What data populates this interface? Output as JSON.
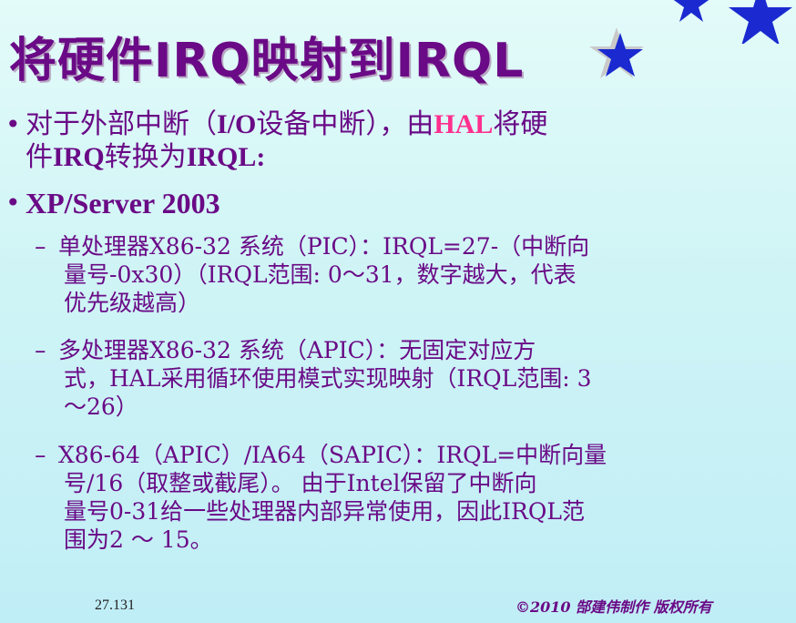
{
  "title": "将硬件IRQ映射到IRQL",
  "bullet1": {
    "line1_pre": "对于外部中断（",
    "line1_io": "I/O",
    "line1_mid": "设备中断），由",
    "line1_hal": "HAL",
    "line1_post": "将硬",
    "line2_pre": "件",
    "line2_irq": "IRQ",
    "line2_mid": "转换为",
    "line2_irql": "IRQL:"
  },
  "bullet2": {
    "text": "XP/Server 2003"
  },
  "sub1": {
    "line1": "单处理器X86-32 系统（PIC）：IRQL=27-（中断向",
    "line2": "量号-0x30）（IRQL范围: 0～31，数字越大，代表",
    "line3": "优先级越高）"
  },
  "sub2": {
    "line1": "多处理器X86-32 系统（APIC）：无固定对应方",
    "line2": "式，HAL采用循环使用模式实现映射（IRQL范围: 3",
    "line3": "～26）"
  },
  "sub3": {
    "line1": "X86-64（APIC）/IA64（SAPIC）：IRQL=中断向量",
    "line2": "号/16（取整或截尾）。 由于Intel保留了中断向",
    "line3": "量号0-31给一些处理器内部异常使用，因此IRQL范",
    "line4": "围为2 ～ 15。"
  },
  "footer": {
    "page": "27.131",
    "copyright": "©2010 郜建伟制作 版权所有"
  },
  "colors": {
    "title": "#6a0a86",
    "text": "#6a0a86",
    "hal": "#ff2f8e",
    "star": "#1a2ad0"
  }
}
